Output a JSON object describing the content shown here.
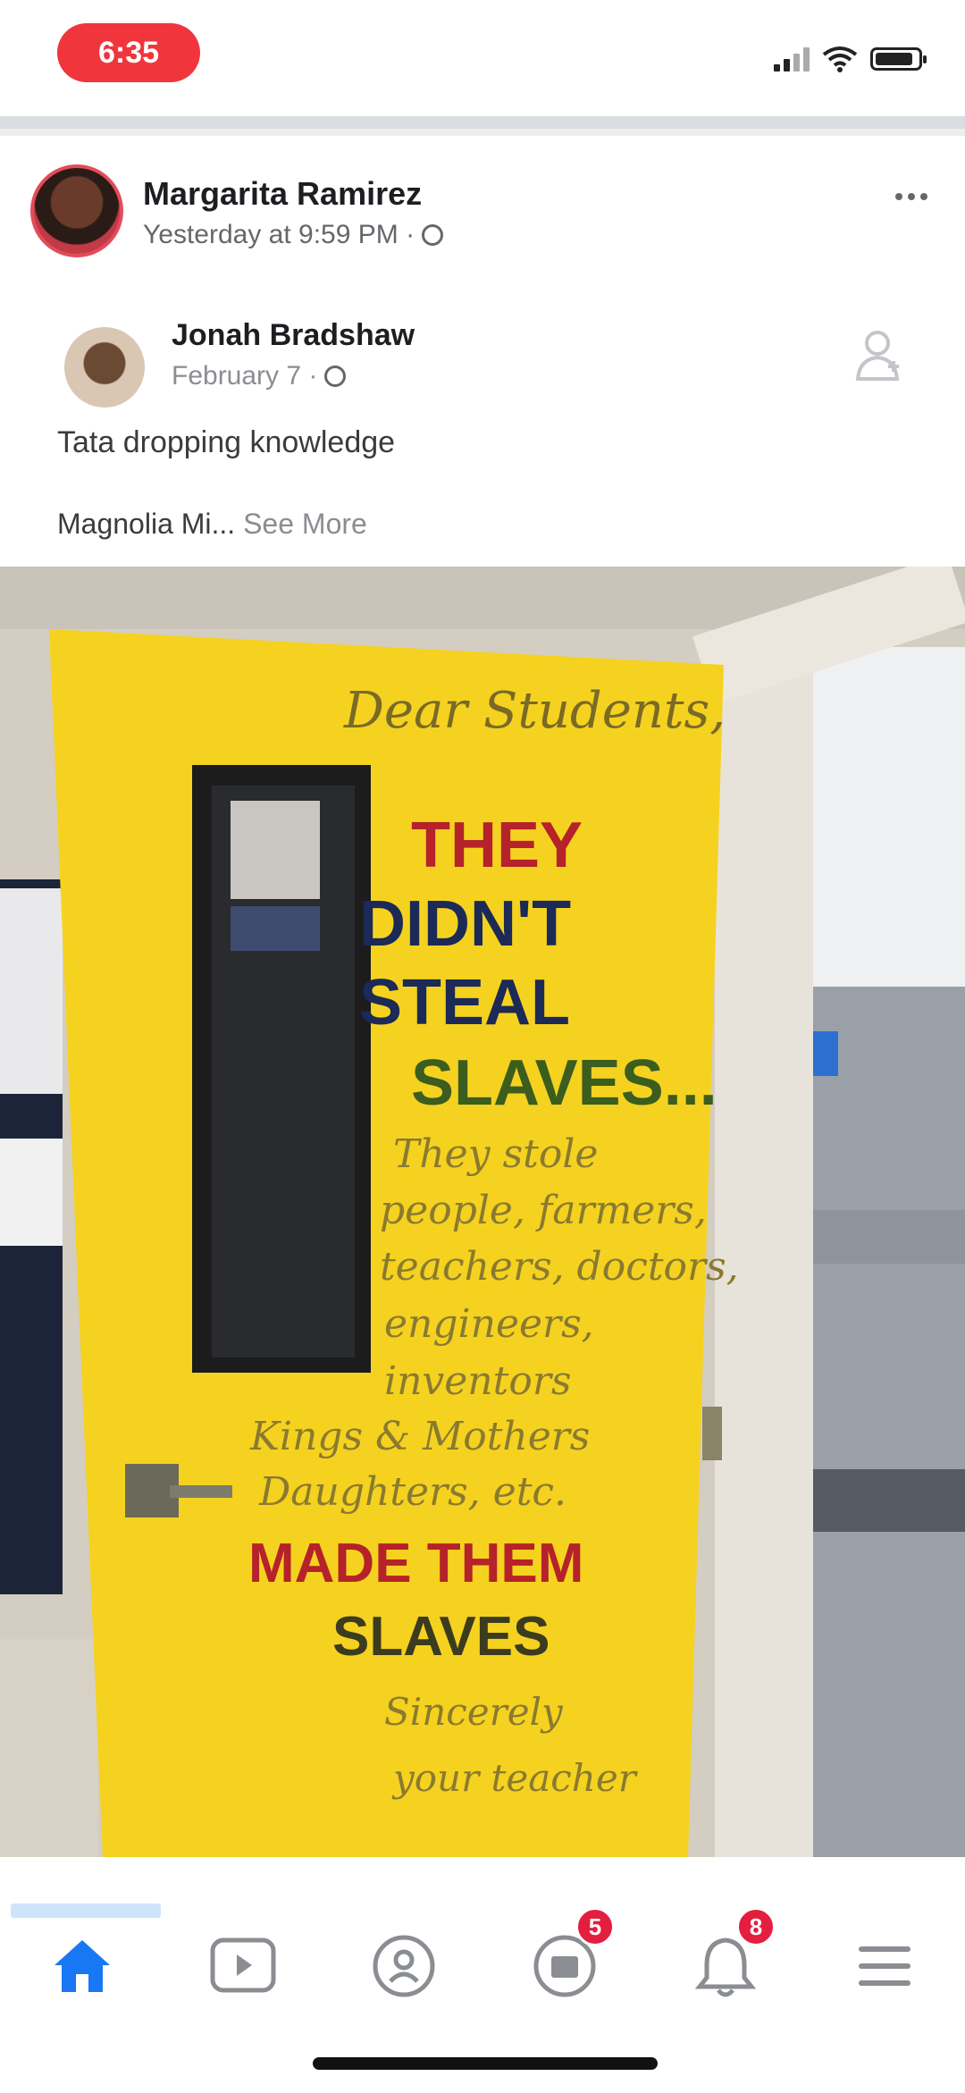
{
  "status_bar": {
    "time": "6:35"
  },
  "post": {
    "author": "Margarita Ramirez",
    "meta": "Yesterday at 9:59 PM ·",
    "shared": {
      "author": "Jonah Bradshaw",
      "meta": "February 7 ·",
      "text": "Tata dropping knowledge",
      "subtext": "Magnolia Mi...",
      "see_more": " See More"
    },
    "photo_sign": {
      "greeting": "Dear Students,",
      "line1": "THEY",
      "line2": "DIDN'T",
      "line3": "STEAL",
      "line4": "SLAVES...",
      "small1": "They stole",
      "small2": "people, farmers,",
      "small3": "teachers, doctors,",
      "small4": "engineers,",
      "small5": "inventors",
      "small6": "Kings & Mothers",
      "small7": "Daughters, etc.",
      "line5": "MADE THEM",
      "line6": "SLAVES",
      "sig1": "Sincerely",
      "sig2": "your teacher"
    }
  },
  "tabs": {
    "notifications_badge": "5",
    "messages_badge": "8"
  },
  "colors": {
    "accent": "#1877f2",
    "badge": "#e41e3f",
    "sign_yellow": "#f5d21f",
    "sign_red": "#b5222a",
    "sign_navy": "#1b2a56",
    "sign_green": "#3b5d1e"
  }
}
